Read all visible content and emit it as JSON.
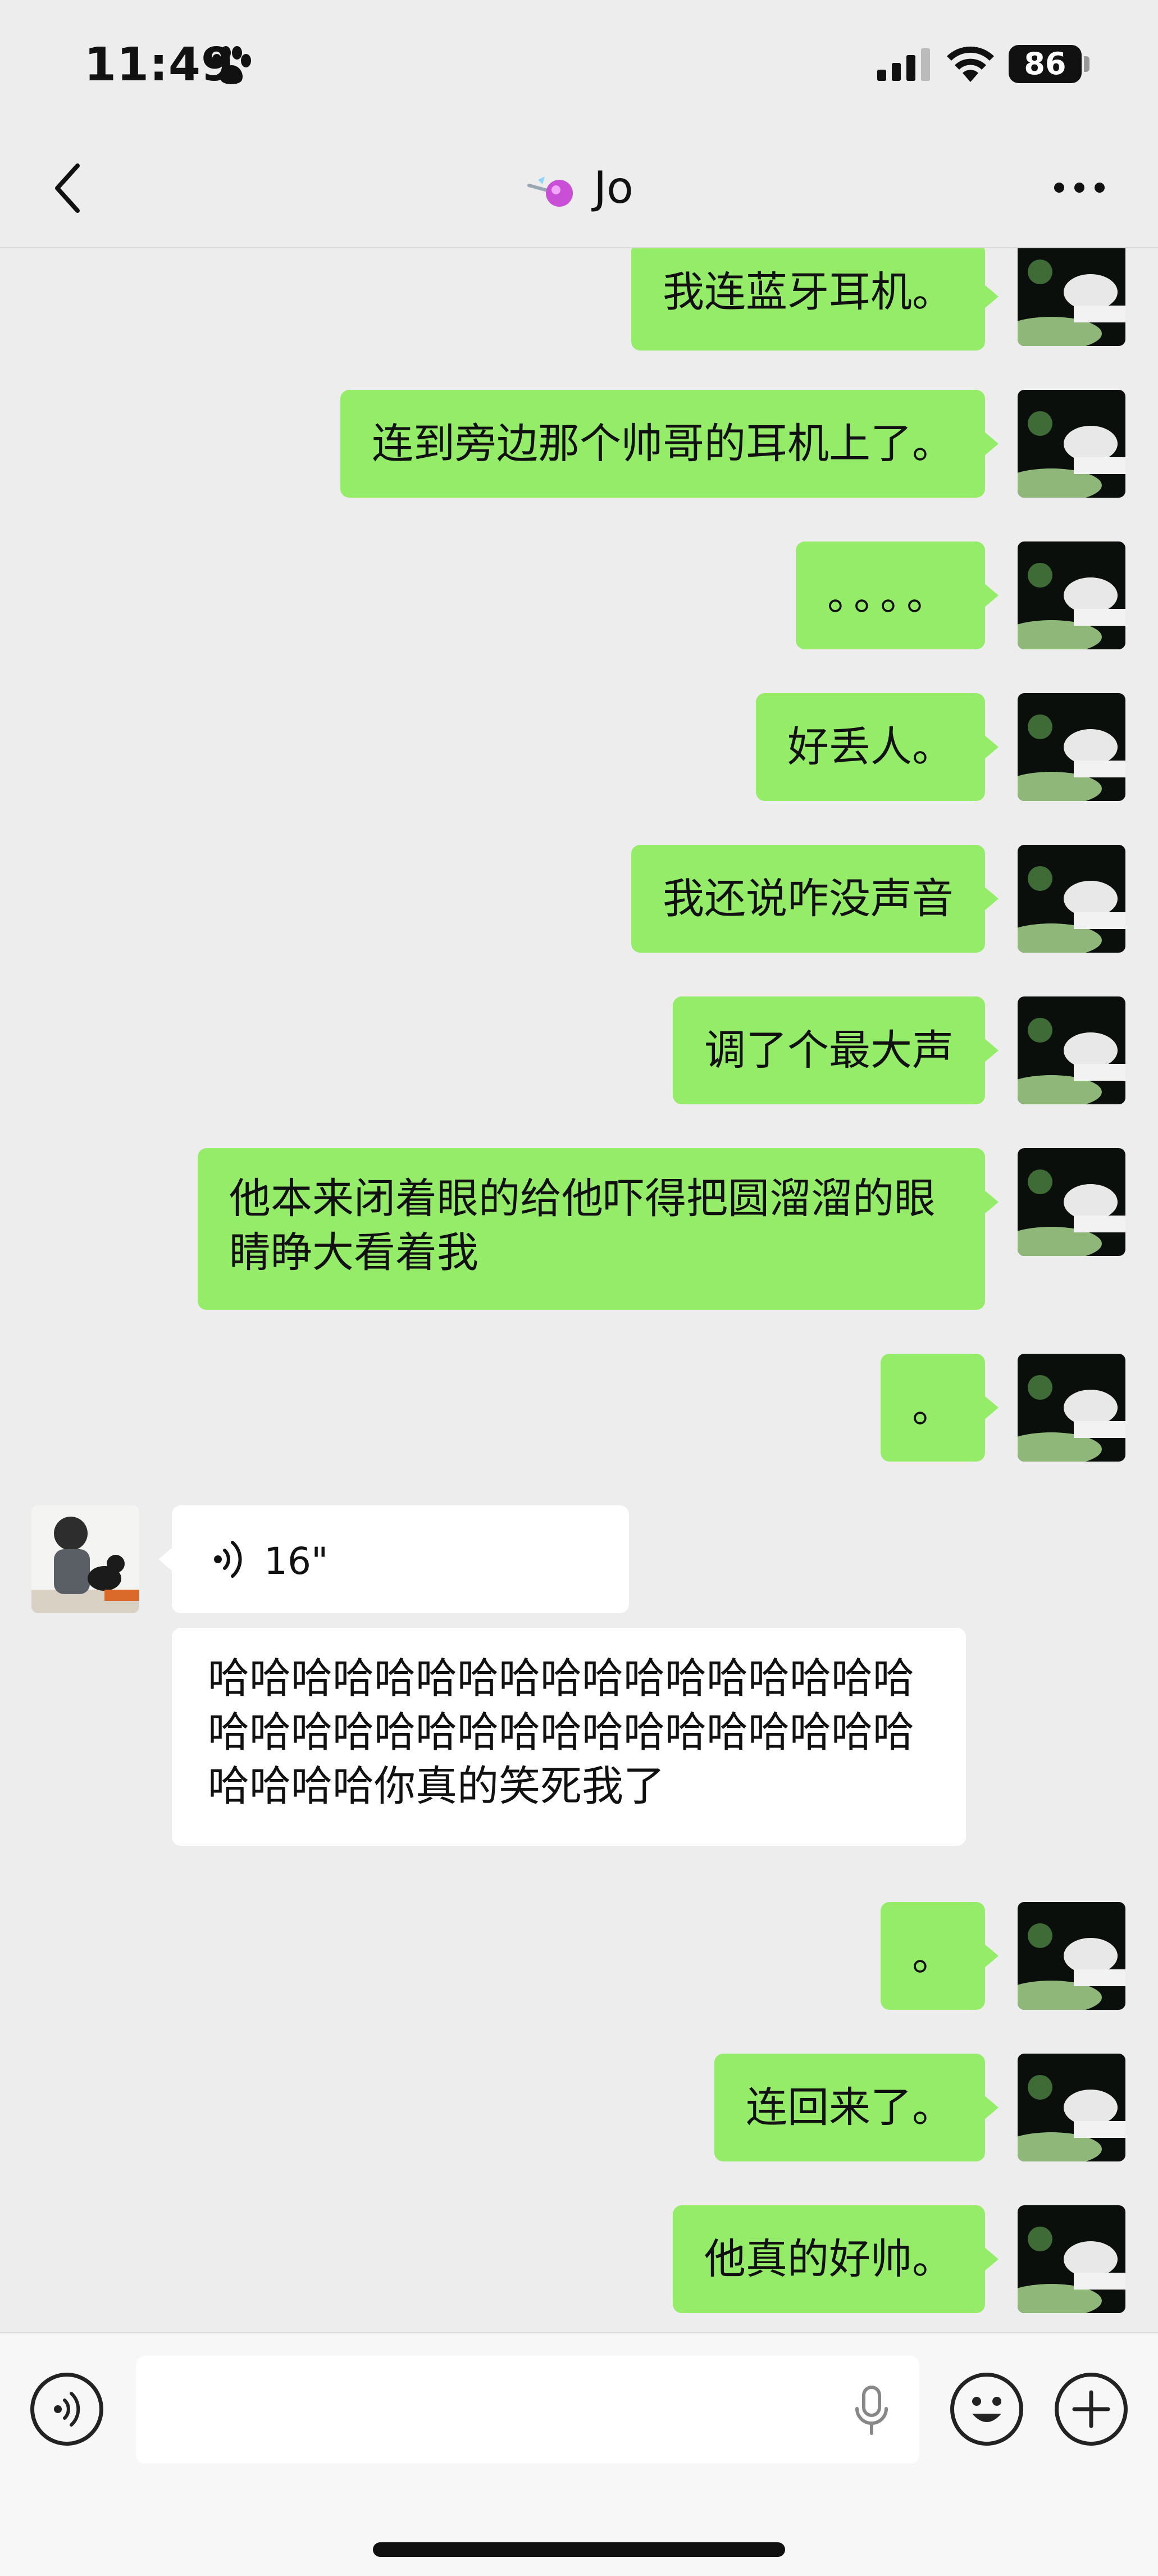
{
  "status_bar": {
    "time": "11:49",
    "battery": "86"
  },
  "nav": {
    "title": "Jo"
  },
  "messages": [
    {
      "side": "me",
      "text": "我连蓝牙耳机。"
    },
    {
      "side": "me",
      "text": "连到旁边那个帅哥的耳机上了。"
    },
    {
      "side": "me",
      "text": "。。。。"
    },
    {
      "side": "me",
      "text": "好丢人。"
    },
    {
      "side": "me",
      "text": "我还说咋没声音"
    },
    {
      "side": "me",
      "text": "调了个最大声"
    },
    {
      "side": "me",
      "text": "他本来闭着眼的给他吓得把圆溜溜的眼睛睁大看着我"
    },
    {
      "side": "me",
      "text": "。"
    },
    {
      "side": "them",
      "voice_duration": "16\""
    },
    {
      "side": "them",
      "text": "哈哈哈哈哈哈哈哈哈哈哈哈哈哈哈哈哈哈哈哈哈哈哈哈哈哈哈哈哈哈哈哈哈哈哈哈哈哈你真的笑死我了"
    },
    {
      "side": "me",
      "text": "。"
    },
    {
      "side": "me",
      "text": "连回来了。"
    },
    {
      "side": "me",
      "text": "他真的好帅。"
    }
  ],
  "colors": {
    "my_bubble": "#95ec69",
    "their_bubble": "#ffffff",
    "background": "#ededed"
  },
  "icons": [
    "paw-icon",
    "signal-icon",
    "wifi-icon",
    "back-icon",
    "candy-icon",
    "more-icon",
    "voice-mode-icon",
    "mic-icon",
    "emoji-icon",
    "plus-icon"
  ]
}
